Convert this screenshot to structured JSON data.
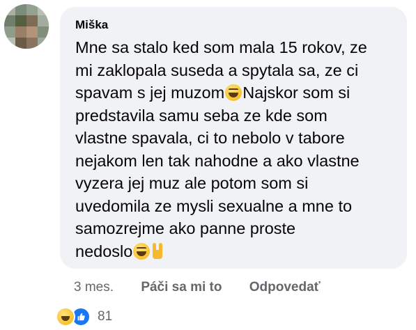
{
  "comment": {
    "author": "Miška",
    "text_part1": "Mne sa stalo ked som mala 15 rokov, ze\nmi zaklopala suseda a spytala sa, ze ci\nspavam s jej muzom",
    "text_part2": "Najskor som si\npredstavila samu seba ze kde som\nvlastne spavala, ci to nebolo v tabore\nnejakom len tak nahodne a ako vlastne\nvyzera jej muz ale potom som si\nuvedomila ze mysli sexualne a mne to\nsamozrejme ako panne proste\nnedoslo",
    "emojis": [
      "grinning-squinting-face",
      "grinning-squinting-face",
      "sign-of-the-horns"
    ]
  },
  "actions": {
    "time": "3 mes.",
    "like_label": "Páči sa mi to",
    "reply_label": "Odpovedať"
  },
  "reactions": {
    "icons": [
      "haha-icon",
      "like-icon"
    ],
    "count": "81"
  },
  "colors": {
    "bubble": "#f0f2f5",
    "secondary_text": "#65676b",
    "like_blue": "#1877f2"
  }
}
